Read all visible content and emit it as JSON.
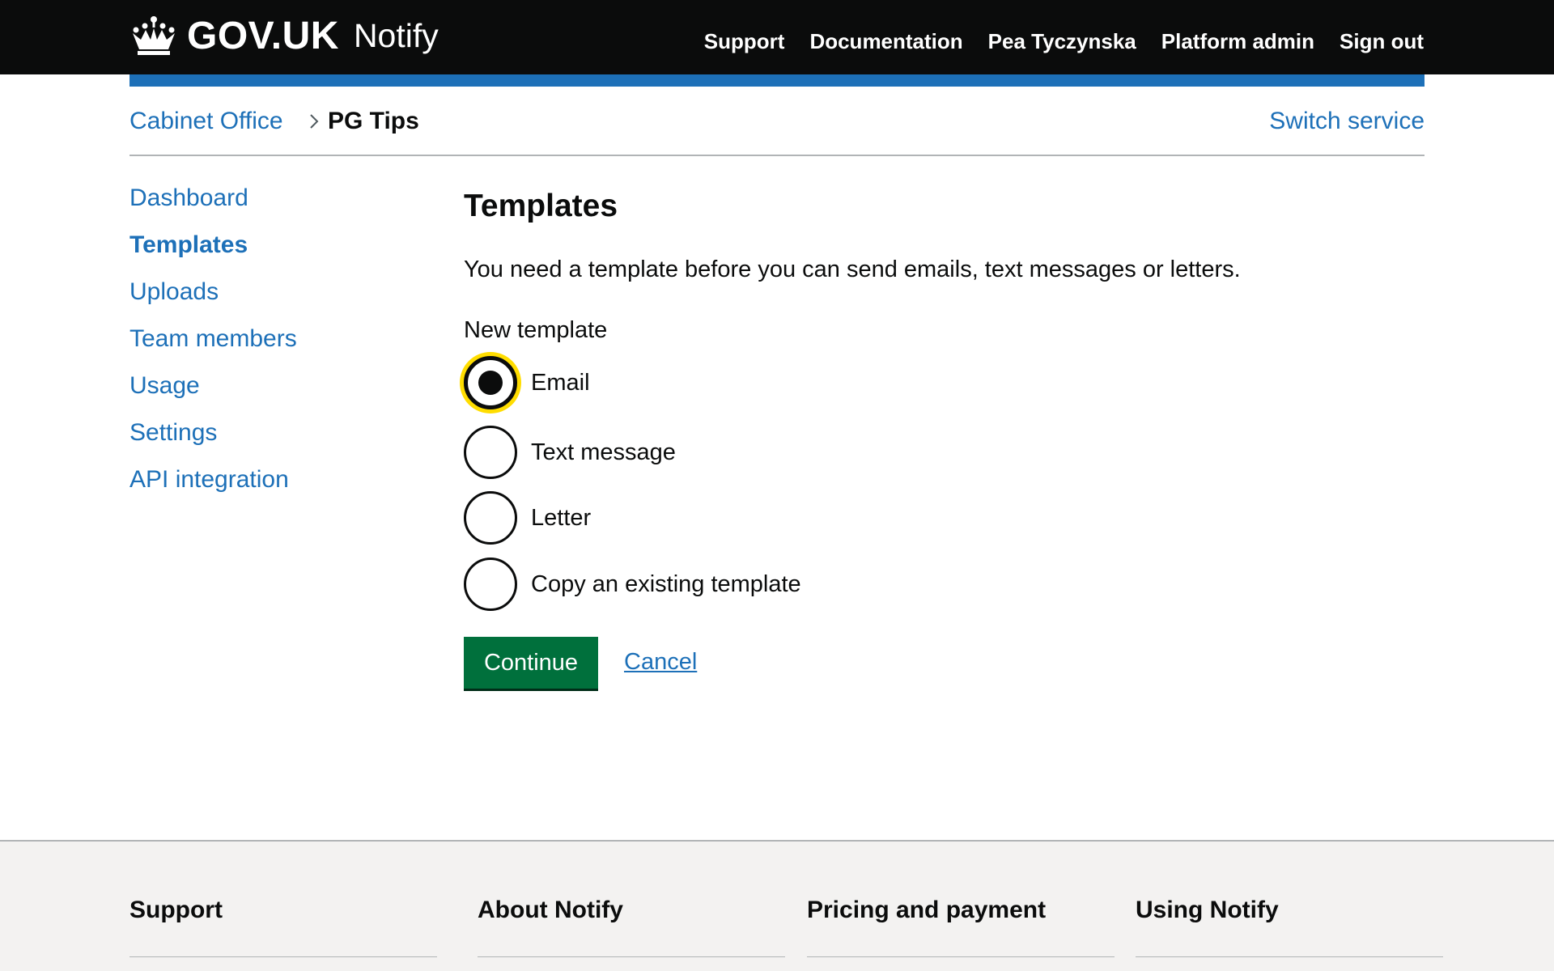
{
  "header": {
    "logo_text": "GOV.UK",
    "service_name": "Notify",
    "nav": [
      "Support",
      "Documentation",
      "Pea Tyczynska",
      "Platform admin",
      "Sign out"
    ]
  },
  "breadcrumb": {
    "organisation": "Cabinet Office",
    "service": "PG Tips",
    "switch_label": "Switch service"
  },
  "sidebar": {
    "items": [
      {
        "label": "Dashboard",
        "active": false
      },
      {
        "label": "Templates",
        "active": true
      },
      {
        "label": "Uploads",
        "active": false
      },
      {
        "label": "Team members",
        "active": false
      },
      {
        "label": "Usage",
        "active": false
      },
      {
        "label": "Settings",
        "active": false
      },
      {
        "label": "API integration",
        "active": false
      }
    ]
  },
  "main": {
    "title": "Templates",
    "lede": "You need a template before you can send emails, text messages or letters.",
    "fieldset_legend": "New template",
    "options": [
      {
        "label": "Email",
        "checked": true
      },
      {
        "label": "Text message",
        "checked": false
      },
      {
        "label": "Letter",
        "checked": false
      },
      {
        "label": "Copy an existing template",
        "checked": false
      }
    ],
    "continue_label": "Continue",
    "cancel_label": "Cancel"
  },
  "footer": {
    "columns": [
      "Support",
      "About Notify",
      "Pricing and payment",
      "Using Notify"
    ]
  },
  "colors": {
    "header_bg": "#0b0c0c",
    "brand_blue": "#1d70b8",
    "button_green": "#00703c",
    "focus_yellow": "#ffdd00",
    "footer_bg": "#f3f2f1"
  }
}
